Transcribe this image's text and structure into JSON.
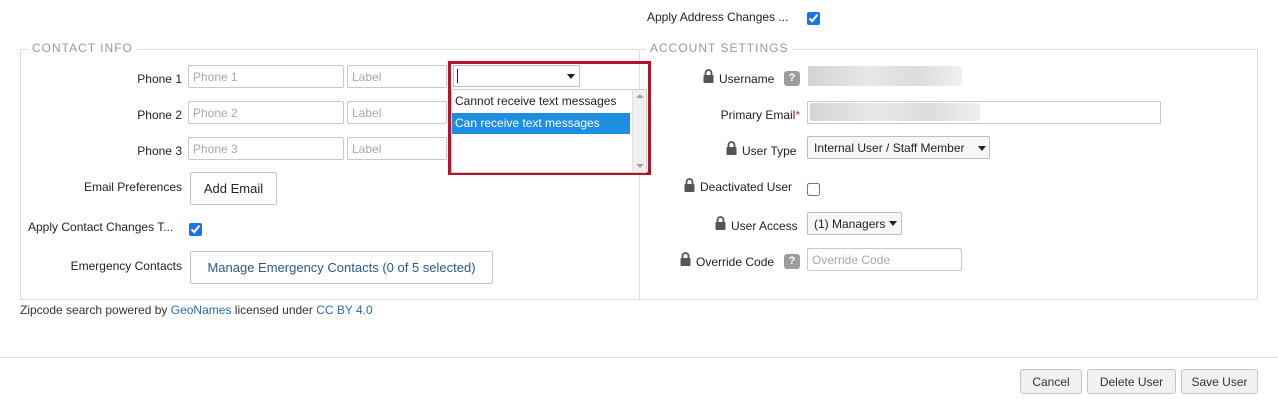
{
  "right_top": {
    "apply_address_label": "Apply Address Changes ...",
    "apply_address_checked": true
  },
  "contact_info": {
    "legend": "CONTACT INFO",
    "phones": [
      {
        "label": "Phone 1",
        "placeholder": "Phone 1",
        "label_placeholder": "Label"
      },
      {
        "label": "Phone 2",
        "placeholder": "Phone 2",
        "label_placeholder": "Label"
      },
      {
        "label": "Phone 3",
        "placeholder": "Phone 3",
        "label_placeholder": "Label"
      }
    ],
    "text_capability_dropdown": {
      "value": "",
      "options": [
        "Cannot receive text messages",
        "Can receive text messages"
      ],
      "highlighted_option": "Can receive text messages"
    },
    "email_preferences_label": "Email Preferences",
    "add_email_button": "Add Email",
    "apply_contact_label": "Apply Contact Changes T...",
    "apply_contact_checked": true,
    "emergency_contacts_label": "Emergency Contacts",
    "manage_emergency_button": "Manage Emergency Contacts (0 of 5 selected)"
  },
  "account_settings": {
    "legend": "ACCOUNT SETTINGS",
    "username_label": "Username",
    "help_glyph": "?",
    "primary_email_label": "Primary Email",
    "required_mark": "*",
    "user_type_label": "User Type",
    "user_type_value": "Internal User / Staff Member",
    "deactivated_label": "Deactivated User",
    "deactivated_checked": false,
    "user_access_label": "User Access",
    "user_access_value": "(1) Managers",
    "override_code_label": "Override Code",
    "override_code_placeholder": "Override Code"
  },
  "footer": {
    "prefix": "Zipcode search powered by ",
    "geonames_link": "GeoNames",
    "middle": " licensed under ",
    "license_link": "CC BY 4.0"
  },
  "actions": {
    "cancel": "Cancel",
    "delete_user": "Delete User",
    "save_user": "Save User"
  },
  "colors": {
    "highlight_border": "#b5122e",
    "selected_option_bg": "#1e8fe0",
    "link": "#2a6ab0"
  },
  "icons": {
    "lock": "lock-icon",
    "help": "help-icon",
    "caret": "caret-down-icon"
  }
}
